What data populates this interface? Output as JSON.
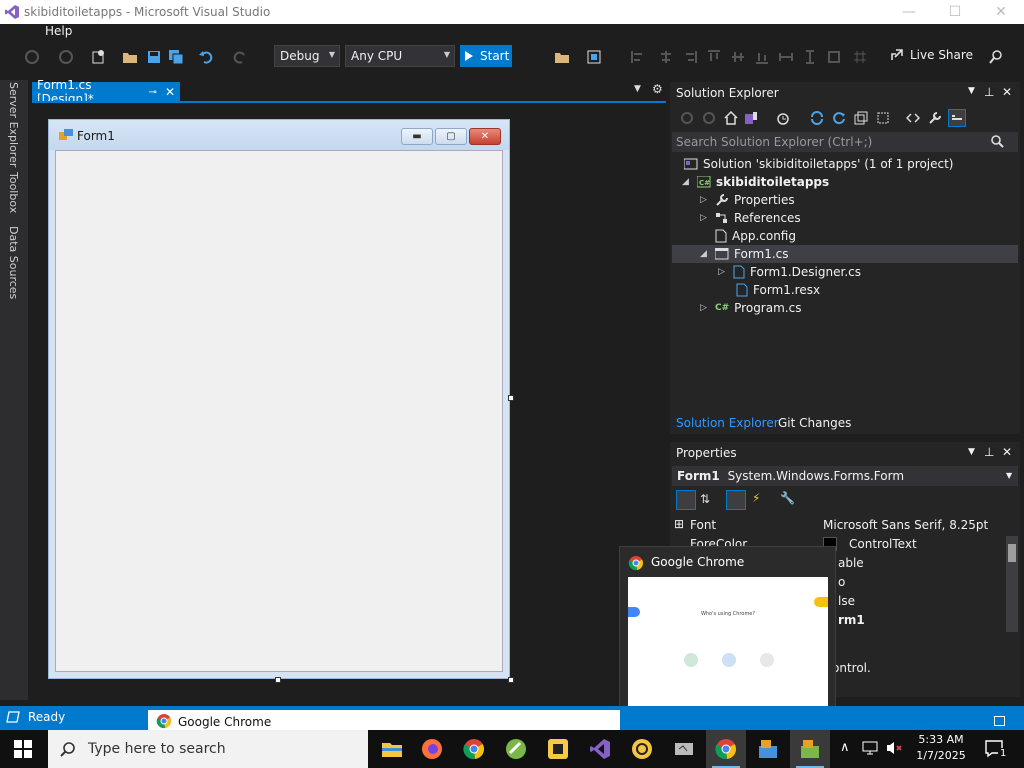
{
  "window": {
    "title": "skibiditoiletapps - Microsoft Visual Studio",
    "controls": [
      "—",
      "☐",
      "✕"
    ]
  },
  "menu": {
    "items": [
      "Help"
    ]
  },
  "toolbar": {
    "config": "Debug",
    "platform": "Any CPU",
    "start_label": "Start",
    "live_share": "Live Share"
  },
  "left_rail": {
    "tabs": [
      "Server Explorer",
      "Toolbox",
      "Data Sources"
    ]
  },
  "editor": {
    "tab_label": "Form1.cs [Design]*",
    "form_title": "Form1"
  },
  "solution_explorer": {
    "title": "Solution Explorer",
    "search_placeholder": "Search Solution Explorer (Ctrl+;)",
    "tree": [
      {
        "label": "Solution 'skibiditoiletapps' (1 of 1 project)",
        "icon": "solution-icon"
      },
      {
        "label": "skibiditoiletapps",
        "icon": "csharp-project-icon",
        "bold": true
      },
      {
        "label": "Properties",
        "icon": "wrench-icon"
      },
      {
        "label": "References",
        "icon": "references-icon"
      },
      {
        "label": "App.config",
        "icon": "config-file-icon"
      },
      {
        "label": "Form1.cs",
        "icon": "form-icon",
        "selected": true
      },
      {
        "label": "Form1.Designer.cs",
        "icon": "cs-file-icon"
      },
      {
        "label": "Form1.resx",
        "icon": "resx-file-icon"
      },
      {
        "label": "Program.cs",
        "icon": "csharp-file-icon"
      }
    ],
    "tabs": [
      "Solution Explorer",
      "Git Changes"
    ]
  },
  "properties": {
    "title": "Properties",
    "object_name": "Form1",
    "object_type": "System.Windows.Forms.Form",
    "rows": [
      {
        "name": "Font",
        "value": "Microsoft Sans Serif, 8.25pt",
        "expandable": true
      },
      {
        "name": "ForeColor",
        "value": "ControlText"
      }
    ],
    "partial_values": [
      "able",
      "o",
      "lse",
      "rm1",
      "ontrol."
    ]
  },
  "chrome_popup": {
    "title": "Google Chrome",
    "thumb_heading": "Who's using Chrome?"
  },
  "status": {
    "text": "Ready",
    "chrome_bar_label": "Google Chrome"
  },
  "taskbar": {
    "search_placeholder": "Type here to search",
    "time": "5:33 AM",
    "date": "1/7/2025",
    "notification_count": "1"
  },
  "colors": {
    "accent": "#007acc",
    "background": "#1e1e1e",
    "panel": "#252526"
  }
}
